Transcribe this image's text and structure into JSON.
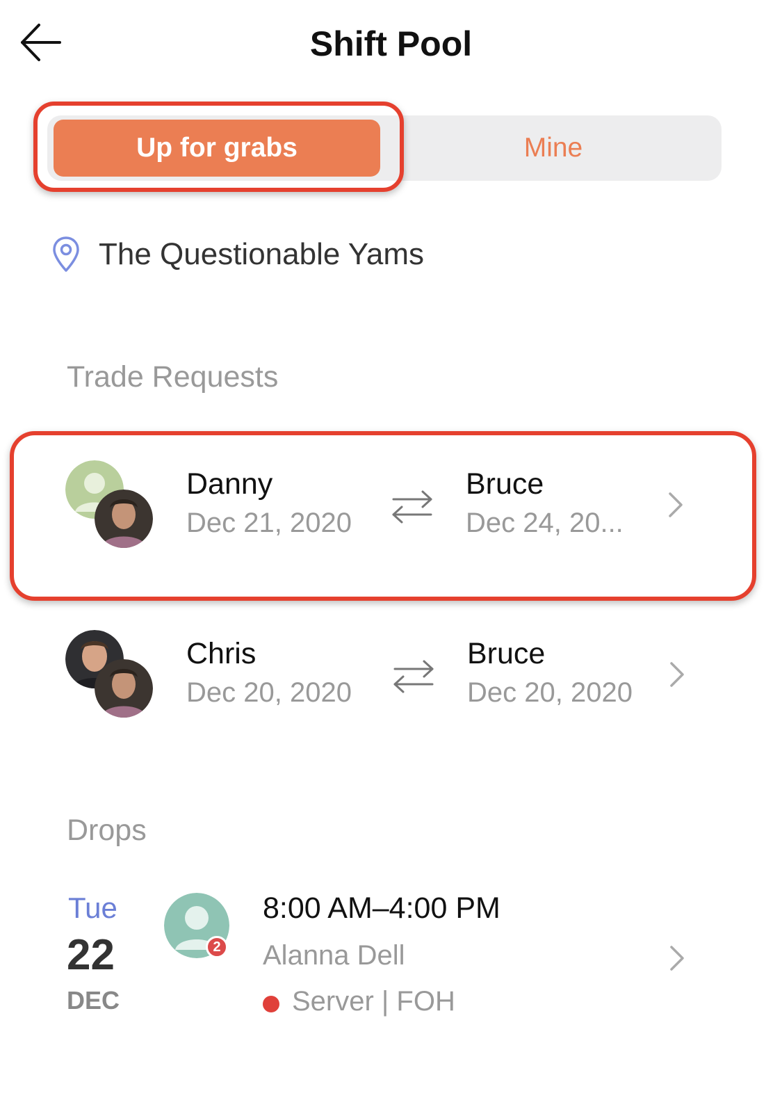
{
  "header": {
    "title": "Shift Pool",
    "back_icon": "arrow-left-icon"
  },
  "tabs": [
    {
      "label": "Up for grabs",
      "active": true
    },
    {
      "label": "Mine",
      "active": false
    }
  ],
  "colors": {
    "accent": "#eb7e53",
    "highlight": "#e5402e",
    "muted": "#999999",
    "day": "#6b7fd6",
    "role_dot": "#e0403a"
  },
  "location": {
    "icon": "map-pin-icon",
    "name": "The Questionable Yams"
  },
  "trade_requests": {
    "title": "Trade Requests",
    "items": [
      {
        "from_name": "Danny",
        "from_date": "Dec 21, 2020",
        "to_name": "Bruce",
        "to_date": "Dec 24, 20..."
      },
      {
        "from_name": "Chris",
        "from_date": "Dec 20, 2020",
        "to_name": "Bruce",
        "to_date": "Dec 20, 2020"
      }
    ]
  },
  "drops": {
    "title": "Drops",
    "items": [
      {
        "day": "Tue",
        "date": "22",
        "month": "DEC",
        "time": "8:00 AM–4:00 PM",
        "person": "Alanna Dell",
        "role": "Server | FOH",
        "badge": "2"
      }
    ]
  }
}
